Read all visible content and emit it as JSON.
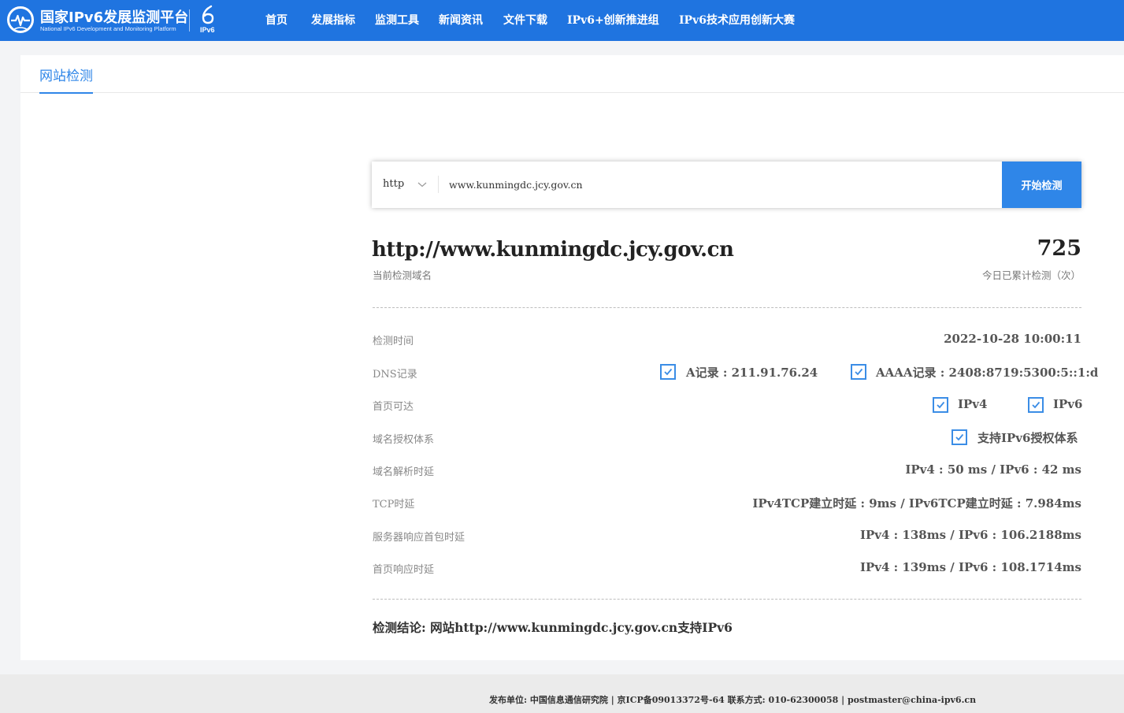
{
  "header": {
    "brand_cn": "国家IPv6发展监测平台",
    "brand_en": "National IPv6 Development and Monitoring Platform",
    "ipv6_logo_text": "IPv6",
    "nav": [
      {
        "label": "首页"
      },
      {
        "label": "发展指标"
      },
      {
        "label": "监测工具"
      },
      {
        "label": "新闻资讯"
      },
      {
        "label": "文件下载"
      },
      {
        "label": "IPv6+创新推进组"
      },
      {
        "label": "IPv6技术应用创新大赛"
      }
    ]
  },
  "tab": {
    "label": "网站检测"
  },
  "search": {
    "protocol": "http",
    "value": "www.kunmingdc.jcy.gov.cn",
    "button": "开始检测"
  },
  "summary": {
    "domain": "http://www.kunmingdc.jcy.gov.cn",
    "domain_label": "当前检测域名",
    "count": "725",
    "count_label": "今日已累计检测（次）"
  },
  "rows": {
    "time": {
      "label": "检测时间",
      "value": "2022-10-28 10:00:11"
    },
    "dns": {
      "label": "DNS记录",
      "a": "A记录 : 211.91.76.24",
      "aaaa": "AAAA记录 : 2408:8719:5300:5::1:d"
    },
    "home": {
      "label": "首页可达",
      "v4": "IPv4",
      "v6": "IPv6"
    },
    "auth": {
      "label": "域名授权体系",
      "value": "支持IPv6授权体系"
    },
    "resolve": {
      "label": "域名解析时延",
      "value": "IPv4 : 50 ms / IPv6 : 42 ms"
    },
    "tcp": {
      "label": "TCP时延",
      "value": "IPv4TCP建立时延 : 9ms / IPv6TCP建立时延 : 7.984ms"
    },
    "server": {
      "label": "服务器响应首包时延",
      "value": "IPv4 : 138ms / IPv6 : 106.2188ms"
    },
    "homepage": {
      "label": "首页响应时延",
      "value": "IPv4 : 139ms / IPv6 : 108.1714ms"
    }
  },
  "conclusion": "检测结论:  网站http://www.kunmingdc.jcy.gov.cn支持IPv6",
  "footer": "发布单位:  中国信息通信研究院 | 京ICP备09013372号-64 联系方式:  010-62300058 | postmaster@china-ipv6.cn",
  "colors": {
    "header_bg": "#1f74e0",
    "accent": "#2f86e8",
    "check": "#3b8de6"
  }
}
